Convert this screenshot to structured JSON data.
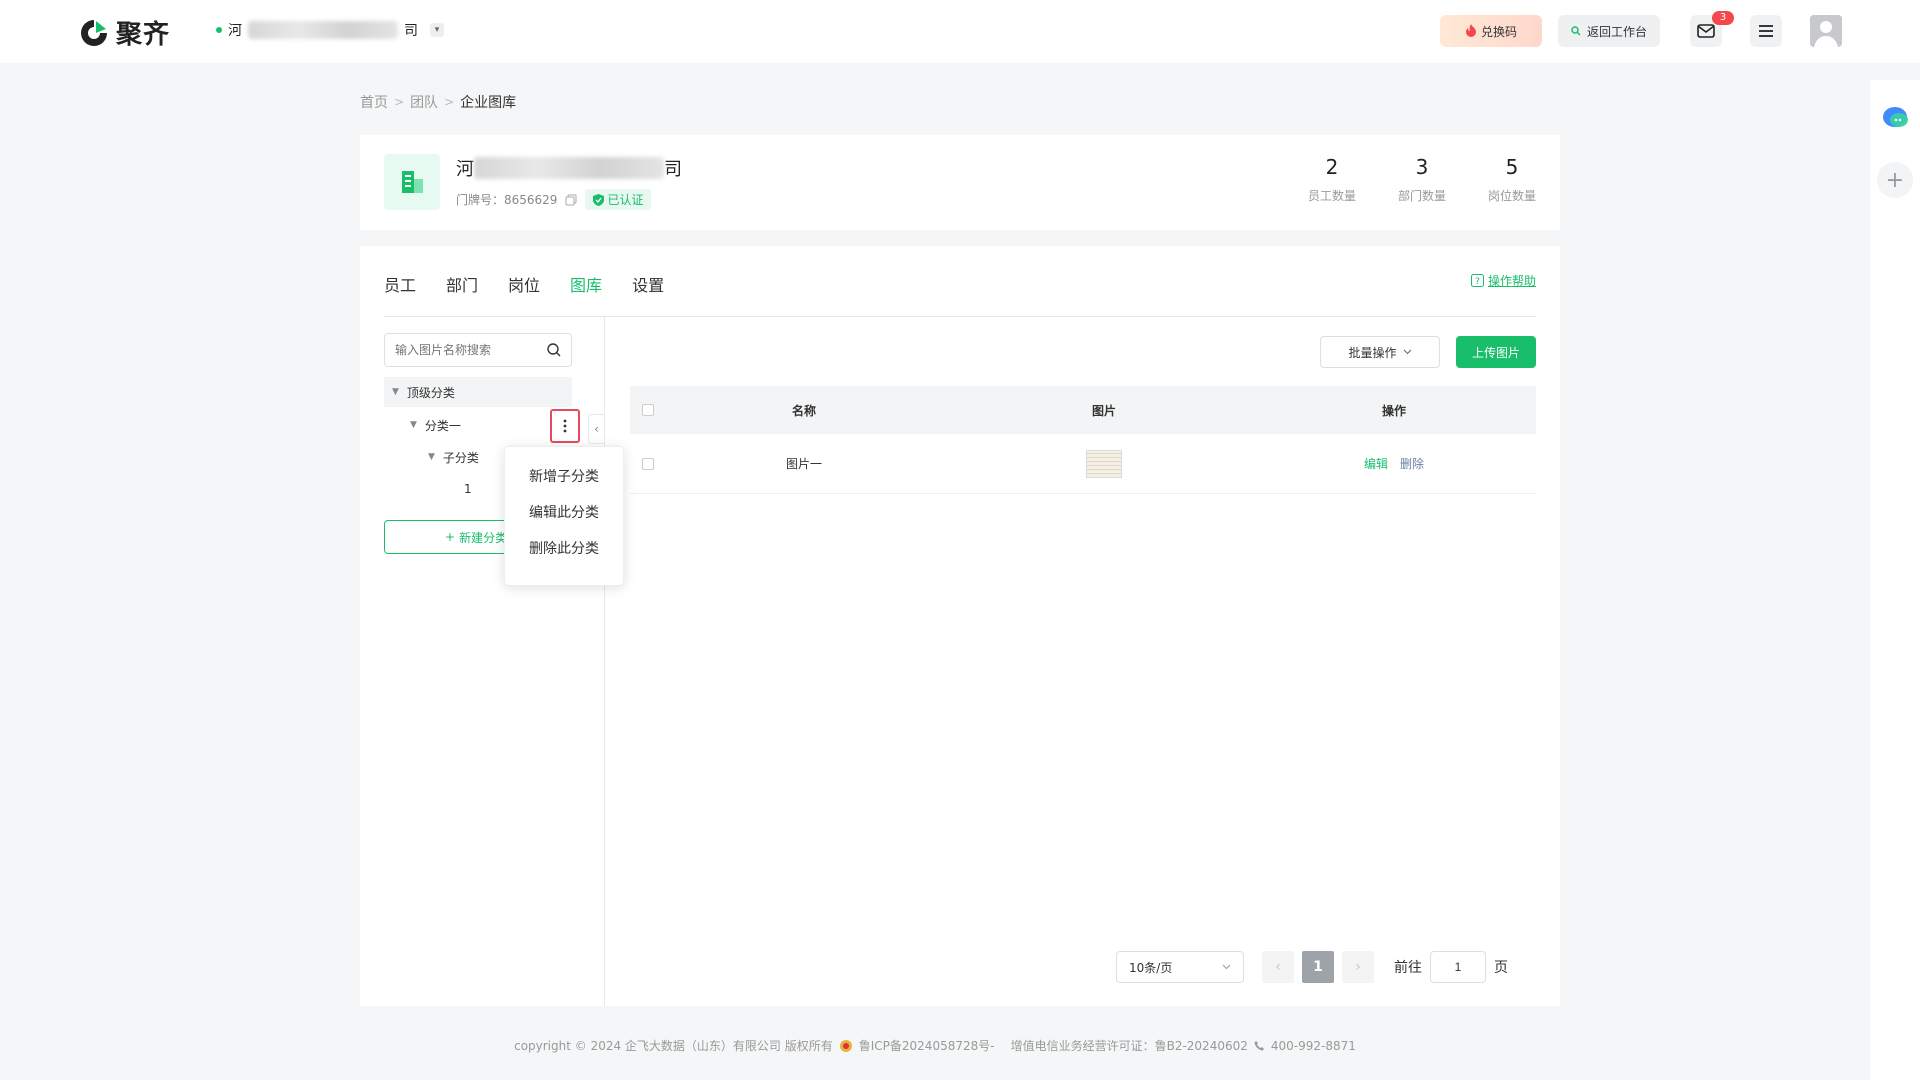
{
  "header": {
    "logo_text": "聚齐",
    "org_name_prefix": "河",
    "org_name_suffix": "司",
    "redeem_label": "兑换码",
    "back_label": "返回工作台",
    "mail_badge": "3"
  },
  "breadcrumb": {
    "home": "首页",
    "team": "团队",
    "current": "企业图库",
    "sep": ">"
  },
  "company": {
    "name_prefix": "河",
    "name_suffix": "司",
    "door_label": "门牌号：8656629",
    "verified_label": "已认证",
    "stats": [
      {
        "num": "2",
        "label": "员工数量"
      },
      {
        "num": "3",
        "label": "部门数量"
      },
      {
        "num": "5",
        "label": "岗位数量"
      }
    ]
  },
  "tabs": [
    {
      "label": "员工",
      "active": false
    },
    {
      "label": "部门",
      "active": false
    },
    {
      "label": "岗位",
      "active": false
    },
    {
      "label": "图库",
      "active": true
    },
    {
      "label": "设置",
      "active": false
    }
  ],
  "help_label": "操作帮助",
  "tree": {
    "search_placeholder": "输入图片名称搜索",
    "top": "顶级分类",
    "cat1": "分类一",
    "sub": "子分类",
    "leaf": "1",
    "new_label": "新建分类"
  },
  "context_menu": [
    "新增子分类",
    "编辑此分类",
    "删除此分类"
  ],
  "toolbar": {
    "batch_label": "批量操作",
    "upload_label": "上传图片"
  },
  "table": {
    "headers": [
      "名称",
      "图片",
      "操作"
    ],
    "rows": [
      {
        "name": "图片一",
        "edit": "编辑",
        "delete": "删除"
      }
    ]
  },
  "pagination": {
    "page_size": "10条/页",
    "current": "1",
    "goto_label": "前往",
    "goto_value": "1",
    "page_suffix": "页"
  },
  "footer": {
    "copyright": "copyright © 2024 企飞大数据（山东）有限公司 版权所有",
    "icp": "鲁ICP备2024058728号-",
    "license": "增值电信业务经营许可证：鲁B2-20240602",
    "phone": "400-992-8871"
  },
  "colors": {
    "accent": "#19be6b",
    "danger": "#e84a5f"
  }
}
